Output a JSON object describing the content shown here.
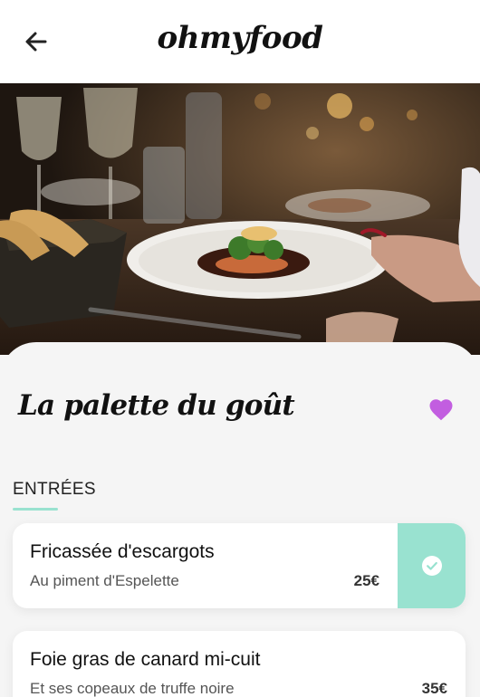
{
  "app": {
    "logo": "ohmyfood"
  },
  "restaurant": {
    "name": "La palette du goût"
  },
  "menu": {
    "section_title": "ENTRÉES",
    "dishes": [
      {
        "name": "Fricassée d'escargots",
        "description": "Au piment d'Espelette",
        "price": "25€",
        "selected": true
      },
      {
        "name": "Foie gras de canard mi-cuit",
        "description": "Et ses copeaux de truffe noire",
        "price": "35€",
        "selected": false
      }
    ]
  },
  "icons": {
    "back": "arrow-left-icon",
    "favorite": "heart-icon",
    "selected": "check-circle-icon"
  },
  "colors": {
    "accent": "#99e2d0",
    "heart": "#c25ee0",
    "background": "#f5f5f5"
  }
}
